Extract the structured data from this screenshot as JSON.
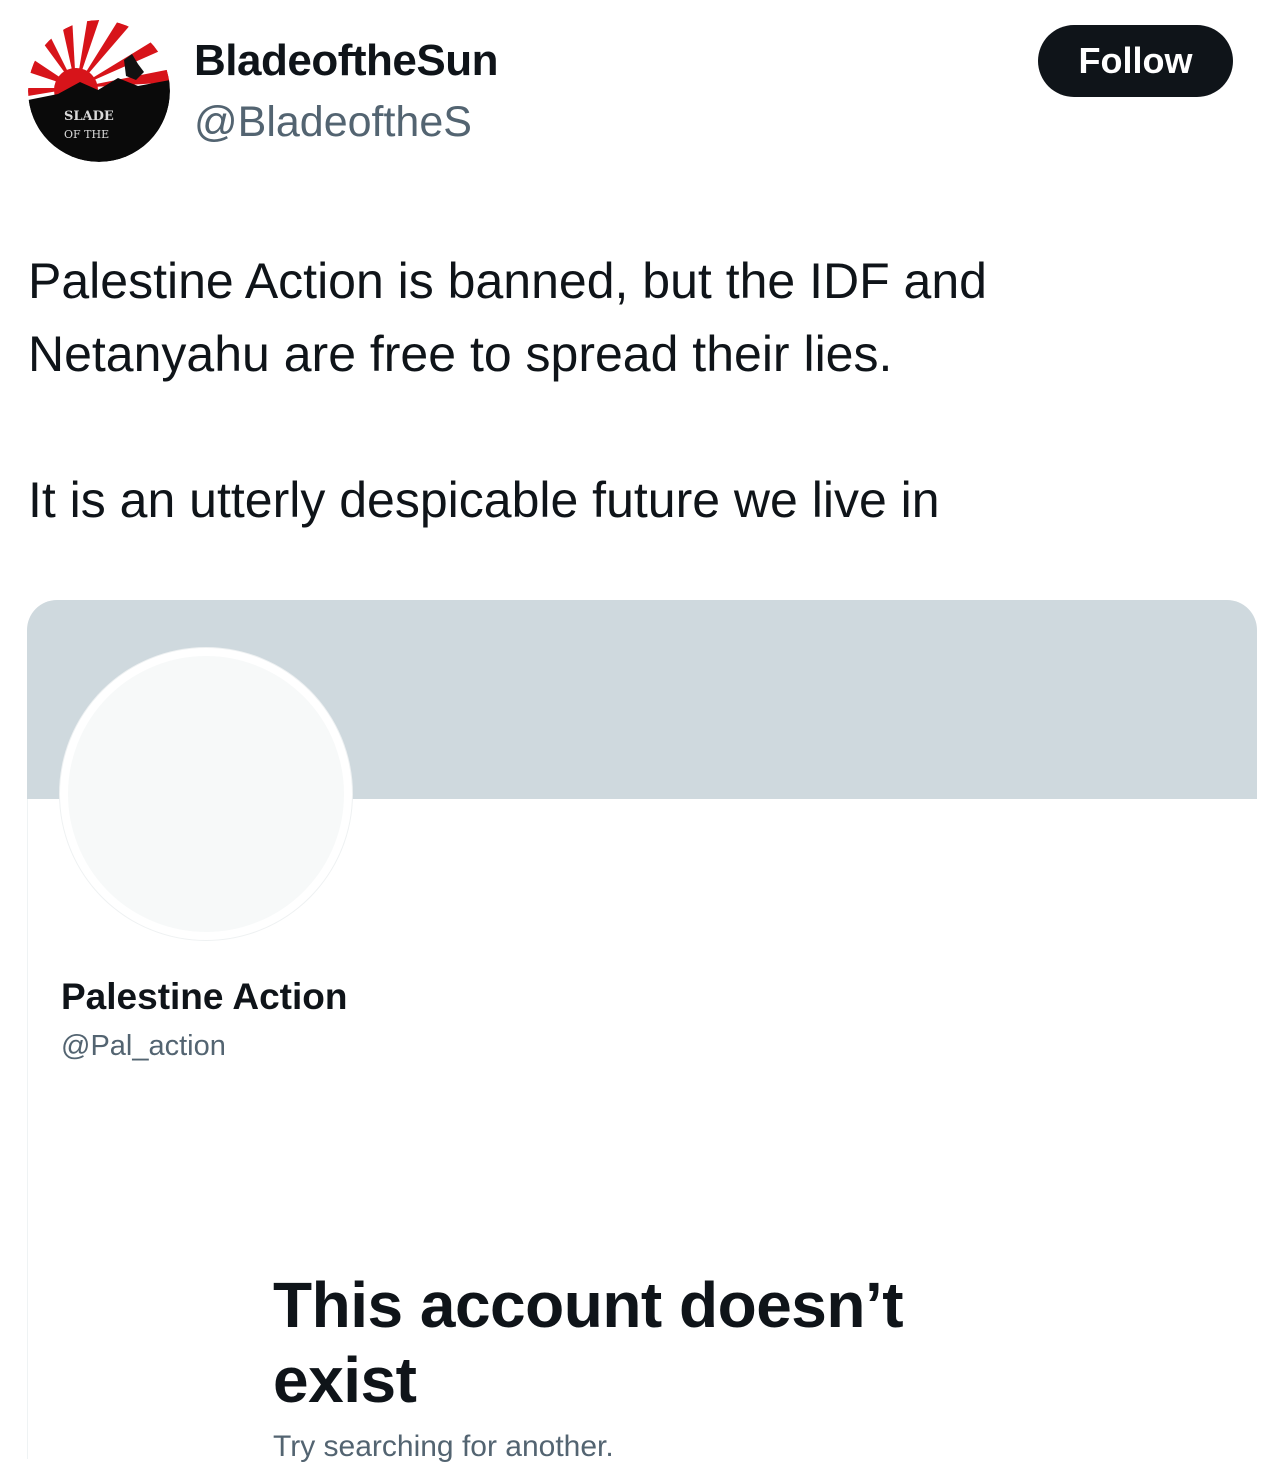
{
  "tweet": {
    "author": {
      "display_name": "BladeoftheSun",
      "handle": "@BladeoftheS",
      "avatar_icon": "rising-sun-avatar",
      "avatar_text": "BLADE OF THE SUN"
    },
    "follow_label": "Follow",
    "text_lines": [
      "Palestine Action is banned, but the IDF and",
      "Netanyahu are free to spread their lies.",
      "It is an utterly despicable future we live in"
    ]
  },
  "embedded_screenshot": {
    "display_name": "Palestine Action",
    "handle": "@Pal_action",
    "message_title": "This account doesn’t exist",
    "message_subtitle": "Try searching for another."
  },
  "colors": {
    "text_primary": "#0f1419",
    "text_secondary": "#536471",
    "follow_bg": "#0f1419",
    "banner": "#cfd9de",
    "avatar_placeholder": "#f7f9f9",
    "sun_red": "#d7141a"
  }
}
